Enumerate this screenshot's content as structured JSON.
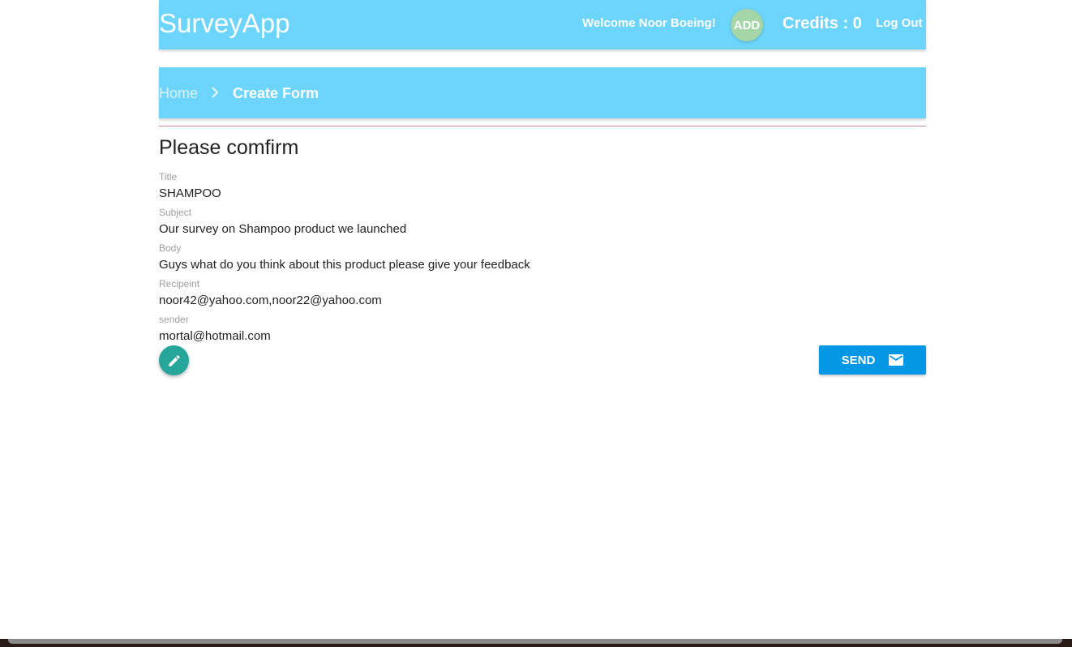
{
  "navbar": {
    "brand": "SurveyApp",
    "welcome": "Welcome Noor Boeing!",
    "add_label": "ADD",
    "credits": "Credits : 0",
    "logout": "Log Out"
  },
  "breadcrumb": {
    "home": "Home",
    "separator_icon": "chevron-right-icon",
    "current": "Create Form"
  },
  "heading": "Please comfirm",
  "fields": [
    {
      "label": "Title",
      "value": "SHAMPOO"
    },
    {
      "label": "Subject",
      "value": "Our survey on Shampoo product we launched"
    },
    {
      "label": "Body",
      "value": "Guys what do you think about this product please give your feedback"
    },
    {
      "label": "Recipeint",
      "value": "noor42@yahoo.com,noor22@yahoo.com"
    },
    {
      "label": "sender",
      "value": "mortal@hotmail.com"
    }
  ],
  "actions": {
    "edit_icon": "pencil-icon",
    "send_label": "SEND",
    "send_icon": "mail-icon"
  },
  "colors": {
    "navbar": "#6dd5fb",
    "add_button": "#a5d6a7",
    "edit_button": "#26a69a",
    "send_button": "#0497e6"
  }
}
